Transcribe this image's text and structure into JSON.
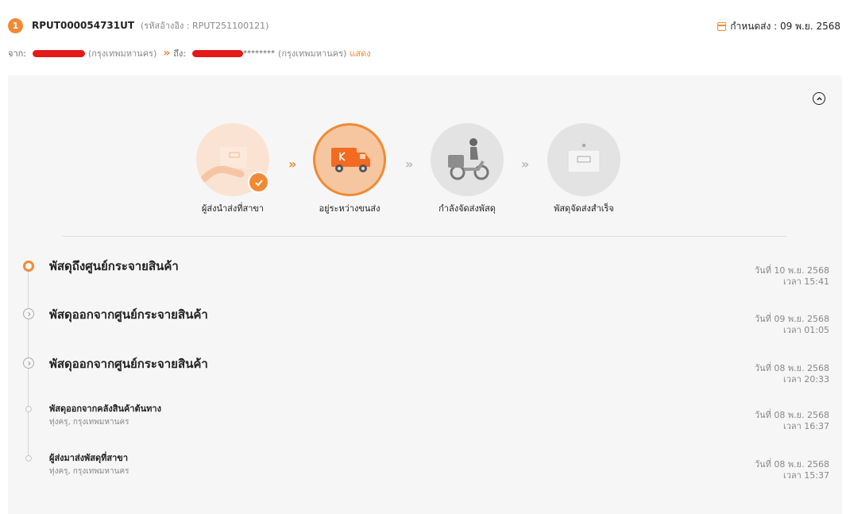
{
  "header": {
    "index": "1",
    "tracking_no": "RPUT000054731UT",
    "ref": "(รหัสอ้างอิง : RPUT251100121)",
    "due": "กำหนดส่ง : 09 พ.ย. 2568"
  },
  "route": {
    "from_label": "จาก:",
    "from_city": "(กรุงเทพมหานคร)",
    "to_label": "ถึง:",
    "to_masked": "********",
    "to_city": "(กรุงเทพมหานคร)",
    "show_link": "แสดง"
  },
  "steps": [
    {
      "label": "ผู้ส่งนำส่งที่สาขา",
      "state": "done"
    },
    {
      "label": "อยู่ระหว่างขนส่ง",
      "state": "current"
    },
    {
      "label": "กำลังจัดส่งพัสดุ",
      "state": "pending"
    },
    {
      "label": "พัสดุจัดส่งสำเร็จ",
      "state": "pending"
    }
  ],
  "timeline": [
    {
      "title": "พัสดุถึงศูนย์กระจายสินค้า",
      "date": "วันที่ 10 พ.ย. 2568",
      "time": "เวลา 15:41"
    },
    {
      "title": "พัสดุออกจากศูนย์กระจายสินค้า",
      "date": "วันที่ 09 พ.ย. 2568",
      "time": "เวลา 01:05"
    },
    {
      "title": "พัสดุออกจากศูนย์กระจายสินค้า",
      "date": "วันที่ 08 พ.ย. 2568",
      "time": "เวลา 20:33"
    },
    {
      "title": "พัสดุออกจากคลังสินค้าต้นทาง",
      "location": "ทุ่งครุ, กรุงเทพมหานคร",
      "date": "วันที่ 08 พ.ย. 2568",
      "time": "เวลา 16:37"
    },
    {
      "title": "ผู้ส่งมาส่งพัสดุที่สาขา",
      "location": "ทุ่งครุ, กรุงเทพมหานคร",
      "date": "วันที่ 08 พ.ย. 2568",
      "time": "เวลา 15:37"
    }
  ],
  "colors": {
    "accent": "#f08a35",
    "redaction": "#e41a1a",
    "panel_bg": "#f6f6f6"
  },
  "icons": [
    "calendar-icon",
    "chevron-up-circle-icon",
    "check-icon",
    "chevron-right-circle-icon"
  ]
}
